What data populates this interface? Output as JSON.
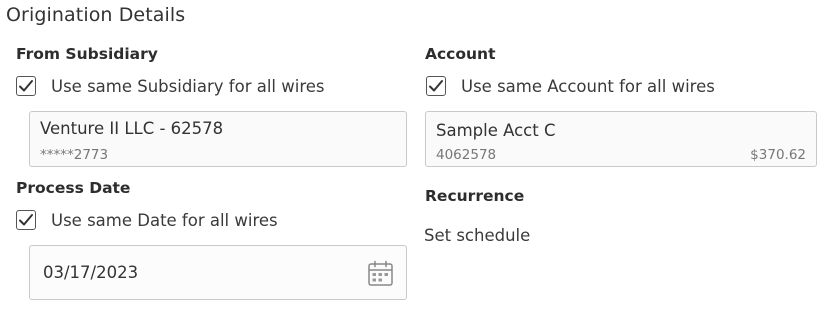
{
  "section_title": "Origination Details",
  "subsidiary": {
    "label": "From Subsidiary",
    "checkbox_label": "Use same Subsidiary for all wires",
    "checked": true,
    "name": "Venture II LLC - 62578",
    "masked_number": "*****2773"
  },
  "account": {
    "label": "Account",
    "checkbox_label": "Use same Account for all wires",
    "checked": true,
    "name": "Sample Acct C",
    "number": "4062578",
    "balance": "$370.62"
  },
  "process_date": {
    "label": "Process Date",
    "checkbox_label": "Use same Date for all wires",
    "checked": true,
    "value": "03/17/2023",
    "icon": "calendar-icon"
  },
  "recurrence": {
    "label": "Recurrence",
    "link_text": "Set schedule"
  },
  "colors": {
    "text": "#333333",
    "muted": "#777777",
    "border": "#c9c9c9",
    "field_bg": "#fafafa"
  }
}
